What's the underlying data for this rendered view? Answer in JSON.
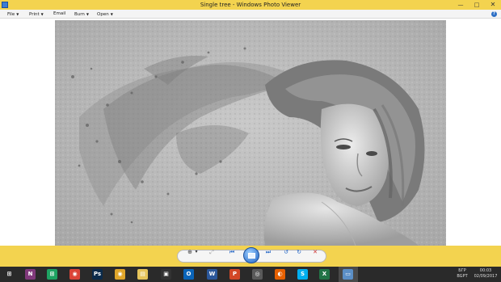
{
  "window": {
    "title": "Single tree - Windows Photo Viewer",
    "min_glyph": "—",
    "max_glyph": "□",
    "close_glyph": "✕"
  },
  "menu": {
    "file": "File",
    "print": "Print",
    "email": "Email",
    "burn": "Burn",
    "open": "Open",
    "caret": "▼",
    "help": "?"
  },
  "toolbar": {
    "zoom_glyph": "⊕",
    "zoom_caret": "▾",
    "actual_size_glyph": "⤢",
    "previous_glyph": "⏮",
    "next_glyph": "⏭",
    "rotate_ccw_glyph": "↺",
    "rotate_cw_glyph": "↻",
    "delete_glyph": "✕"
  },
  "taskbar": {
    "apps": [
      {
        "name": "start-button",
        "glyph": "⊞",
        "color": "#2a2a2a"
      },
      {
        "name": "onenote",
        "glyph": "N",
        "color": "#80397b"
      },
      {
        "name": "store",
        "glyph": "⊞",
        "color": "#1ea362"
      },
      {
        "name": "chrome",
        "glyph": "◉",
        "color": "#db4437"
      },
      {
        "name": "photoshop",
        "glyph": "Ps",
        "color": "#0b2a4a"
      },
      {
        "name": "chrome-2",
        "glyph": "◉",
        "color": "#e0a52a"
      },
      {
        "name": "file-explorer",
        "glyph": "▤",
        "color": "#e6c45a"
      },
      {
        "name": "photos",
        "glyph": "▣",
        "color": "#333333"
      },
      {
        "name": "internet-explorer",
        "glyph": "e",
        "color": "#1f8ad8"
      },
      {
        "name": "outlook",
        "glyph": "O",
        "color": "#0a64b8"
      },
      {
        "name": "word",
        "glyph": "W",
        "color": "#2b579a"
      },
      {
        "name": "powerpoint",
        "glyph": "P",
        "color": "#d24726"
      },
      {
        "name": "firefox",
        "glyph": "◐",
        "color": "#e66000"
      },
      {
        "name": "media",
        "glyph": "◎",
        "color": "#5a5a5a"
      },
      {
        "name": "skype",
        "glyph": "S",
        "color": "#00aff0"
      },
      {
        "name": "excel",
        "glyph": "X",
        "color": "#217346"
      },
      {
        "name": "photo-viewer",
        "glyph": "▭",
        "color": "#5b8fc7"
      }
    ],
    "lang_top": "БГР",
    "lang_bottom": "BGPT",
    "time": "00:03",
    "date": "02/09/2017"
  }
}
